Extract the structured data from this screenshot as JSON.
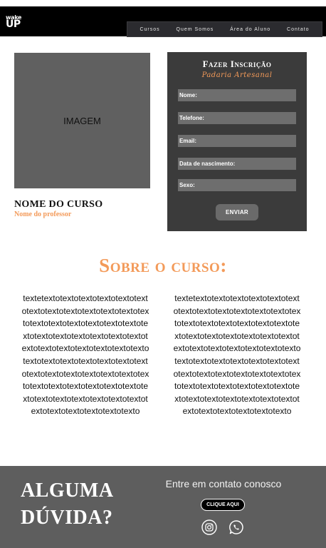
{
  "header": {
    "logo_line1": "wake",
    "logo_line2": "UP",
    "nav": [
      "Cursos",
      "Quem Somos",
      "Área do Aluno",
      "Contato"
    ]
  },
  "course": {
    "image_placeholder": "IMAGEM",
    "name": "NOME DO CURSO",
    "professor": "Nome do professor"
  },
  "form": {
    "title": "Fazer Inscrição",
    "subtitle": "Padaria Artesanal",
    "fields": [
      "Nome:",
      "Telefone:",
      "Email:",
      "Data de nascimento:",
      "Sexo:"
    ],
    "submit_label": "ENVIAR"
  },
  "about": {
    "title": "Sobre o curso:",
    "left_text": "textetextotextotextotextotextotextotextotextotextotextotextotextotextotextotextotextotextotextotextotextotextotextotextotextotextotextotextotextotextotextotextotextotextotextotextotextotextotextotextotextotextotextotextotextotextotextotextotextotextotextotextotextotextotextotextotextotextotextotextotextotextotextotextotextotextotexto",
    "right_text": "textetextotextotextotextotextotextotextotextotextotextotextotextotextotextotextotextotextotextotextotextotextotextotextotextotextotextotextotextotextotextotextotextotextotextotextotextotextotextotextotextotextotextotextotextotextotextotextotextotextotextotextotextotextotextotextotextotextotextotextotextotextotextotextotextotextotexto"
  },
  "footer": {
    "question_line1": "ALGUMA",
    "question_line2": "DÚVIDA?",
    "contact_title": "Entre em contato conosco",
    "button_label": "CLIQUE AQUI",
    "social_icons": [
      "instagram-icon",
      "whatsapp-icon"
    ]
  },
  "colors": {
    "accent": "#f39a59",
    "header_bg": "#000000",
    "form_bg": "#3b3b3b",
    "footer_bg": "#5e5e5e"
  }
}
